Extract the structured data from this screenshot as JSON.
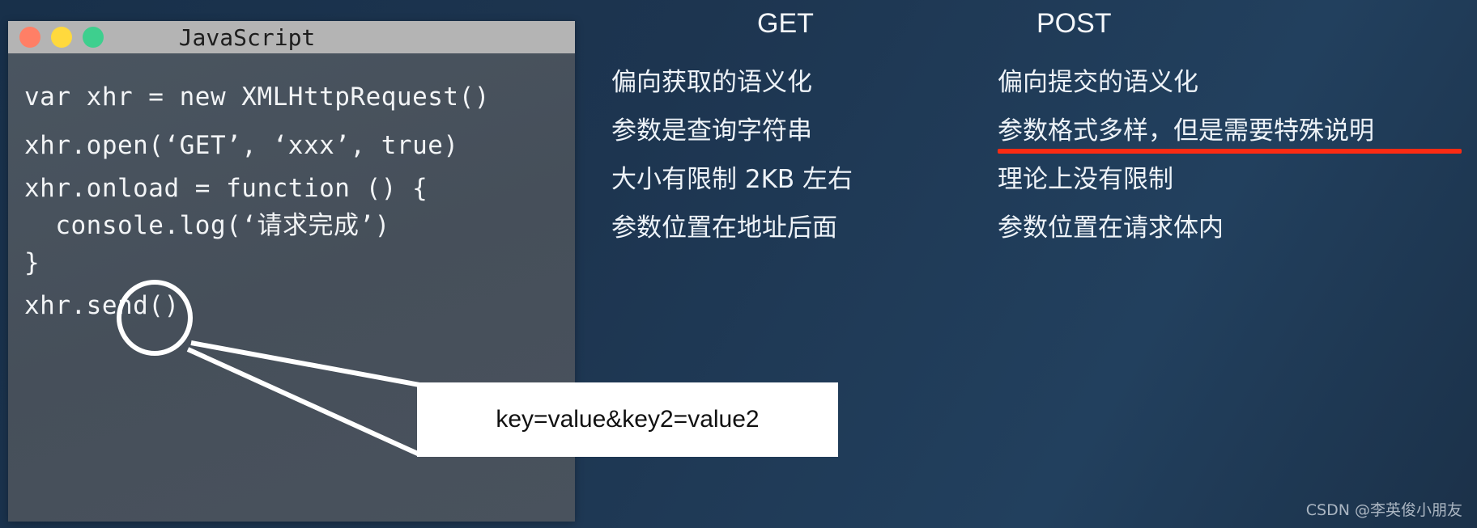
{
  "theme": {
    "background": "#1b3149",
    "code_panel_bg": "#48515c",
    "titlebar_bg": "#b4b4b4",
    "accent_red": "#fb2b13",
    "text_light": "#eef3f8"
  },
  "code_window": {
    "title": "JavaScript",
    "traffic_lights": [
      {
        "name": "close-button",
        "color": "#ff7f66"
      },
      {
        "name": "minimize-button",
        "color": "#ffd93d"
      },
      {
        "name": "maximize-button",
        "color": "#3ecf8e"
      }
    ],
    "code_lines": [
      "var xhr = new XMLHttpRequest()",
      "xhr.open(‘GET’, ‘xxx’, true)",
      "xhr.onload = function () {",
      "  console.log(‘请求完成’)",
      "}",
      "xhr.send()"
    ]
  },
  "annotation": {
    "magnifier_target": "send()",
    "callout_text": "key=value&key2=value2"
  },
  "comparison": {
    "get": {
      "header": "GET",
      "rows": [
        {
          "text": "偏向获取的语义化",
          "underlined": false
        },
        {
          "text": "参数是查询字符串",
          "underlined": false
        },
        {
          "text": "大小有限制  2KB  左右",
          "underlined": false
        },
        {
          "text": "参数位置在地址后面",
          "underlined": false
        }
      ]
    },
    "post": {
      "header": "POST",
      "rows": [
        {
          "text": "偏向提交的语义化",
          "underlined": false
        },
        {
          "text": "参数格式多样，但是需要特殊说明",
          "underlined": true
        },
        {
          "text": "理论上没有限制",
          "underlined": false
        },
        {
          "text": "参数位置在请求体内",
          "underlined": false
        }
      ]
    }
  },
  "watermark": "CSDN @李英俊小朋友"
}
